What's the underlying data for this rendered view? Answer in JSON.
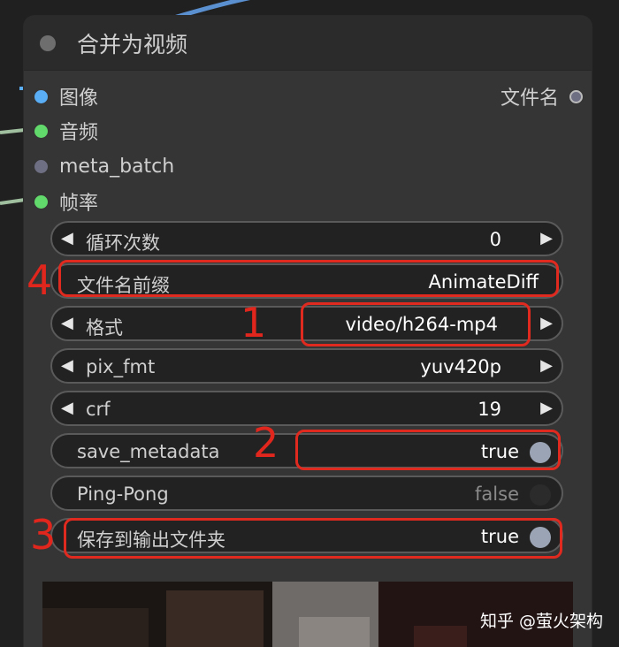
{
  "node": {
    "title": "合并为视频",
    "inputs": [
      {
        "label": "图像",
        "color": "#5aaef5"
      },
      {
        "label": "音频",
        "color": "#62d96b"
      },
      {
        "label": "meta_batch",
        "color": "#6f6f84"
      },
      {
        "label": "帧率",
        "color": "#62d96b"
      }
    ],
    "output": {
      "label": "文件名"
    }
  },
  "widgets": {
    "loop_count": {
      "label": "循环次数",
      "value": "0"
    },
    "filename_prefix": {
      "label": "文件名前缀",
      "value": "AnimateDiff"
    },
    "format": {
      "label": "格式",
      "value": "video/h264-mp4"
    },
    "pix_fmt": {
      "label": "pix_fmt",
      "value": "yuv420p"
    },
    "crf": {
      "label": "crf",
      "value": "19"
    },
    "save_metadata": {
      "label": "save_metadata",
      "value": "true"
    },
    "pingpong": {
      "label": "Ping-Pong",
      "value": "false"
    },
    "save_output": {
      "label": "保存到输出文件夹",
      "value": "true"
    }
  },
  "icons": {
    "arrow_left": "◀",
    "arrow_right": "▶"
  },
  "annotations": {
    "one": "1",
    "two": "2",
    "three": "3",
    "four": "4"
  },
  "watermark": "知乎 @萤火架构",
  "colors": {
    "highlight": "#e02a20",
    "toggle_on": "#9aa4b4",
    "toggle_off": "#2b2b2b"
  }
}
